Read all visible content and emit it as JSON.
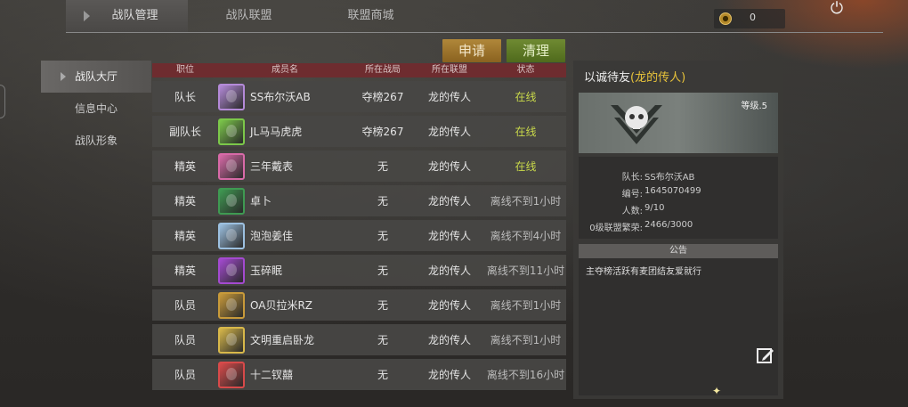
{
  "tabs": [
    {
      "label": "战队管理",
      "active": true
    },
    {
      "label": "战队联盟",
      "active": false
    },
    {
      "label": "联盟商城",
      "active": false
    }
  ],
  "currency": {
    "value": "0",
    "icon": "coin-icon"
  },
  "buttons": {
    "apply": "申请",
    "clear": "清理"
  },
  "nav": [
    {
      "label": "战队大厅",
      "active": true
    },
    {
      "label": "信息中心",
      "active": false
    },
    {
      "label": "战队形象",
      "active": false
    }
  ],
  "table": {
    "headers": [
      "职位",
      "成员名",
      "所在战局",
      "所在联盟",
      "状态"
    ],
    "rows": [
      {
        "position": "队长",
        "name": "SS布尔沃AB",
        "rank": "夺榜267",
        "alliance": "龙的传人",
        "status": "在线",
        "online": true,
        "avatar_color": "#b48ad8"
      },
      {
        "position": "副队长",
        "name": "JL马马虎虎",
        "rank": "夺榜267",
        "alliance": "龙的传人",
        "status": "在线",
        "online": true,
        "avatar_color": "#7cc84a"
      },
      {
        "position": "精英",
        "name": "三年戴表",
        "rank": "无",
        "alliance": "龙的传人",
        "status": "在线",
        "online": true,
        "avatar_color": "#d86aa8"
      },
      {
        "position": "精英",
        "name": "卓卜",
        "rank": "无",
        "alliance": "龙的传人",
        "status": "离线不到1小时",
        "online": false,
        "avatar_color": "#3f9a52"
      },
      {
        "position": "精英",
        "name": "泡泡姜佳",
        "rank": "无",
        "alliance": "龙的传人",
        "status": "离线不到4小时",
        "online": false,
        "avatar_color": "#9cc0e0"
      },
      {
        "position": "精英",
        "name": "玉碎眠",
        "rank": "无",
        "alliance": "龙的传人",
        "status": "离线不到11小时",
        "online": false,
        "avatar_color": "#a44ad0"
      },
      {
        "position": "队员",
        "name": "OA贝拉米RZ",
        "rank": "无",
        "alliance": "龙的传人",
        "status": "离线不到1小时",
        "online": false,
        "avatar_color": "#c89a3a"
      },
      {
        "position": "队员",
        "name": "文明重启卧龙",
        "rank": "无",
        "alliance": "龙的传人",
        "status": "离线不到1小时",
        "online": false,
        "avatar_color": "#d8b84a"
      },
      {
        "position": "队员",
        "name": "十二钗囍",
        "rank": "无",
        "alliance": "龙的传人",
        "status": "离线不到16小时",
        "online": false,
        "avatar_color": "#d84a4a"
      }
    ]
  },
  "team": {
    "title_prefix": "以诚待友",
    "alliance_label": "(龙的传人)",
    "level": "等级.5",
    "info": [
      {
        "key": "队长:",
        "value": "SS布尔沃AB"
      },
      {
        "key": "编号:",
        "value": "1645070499"
      },
      {
        "key": "人数:",
        "value": "9/10"
      },
      {
        "key": "0级联盟繁荣:",
        "value": "2466/3000"
      }
    ],
    "notice_header": "公告",
    "notice_text": "主夺榜活跃有麦团结友爱就行"
  }
}
